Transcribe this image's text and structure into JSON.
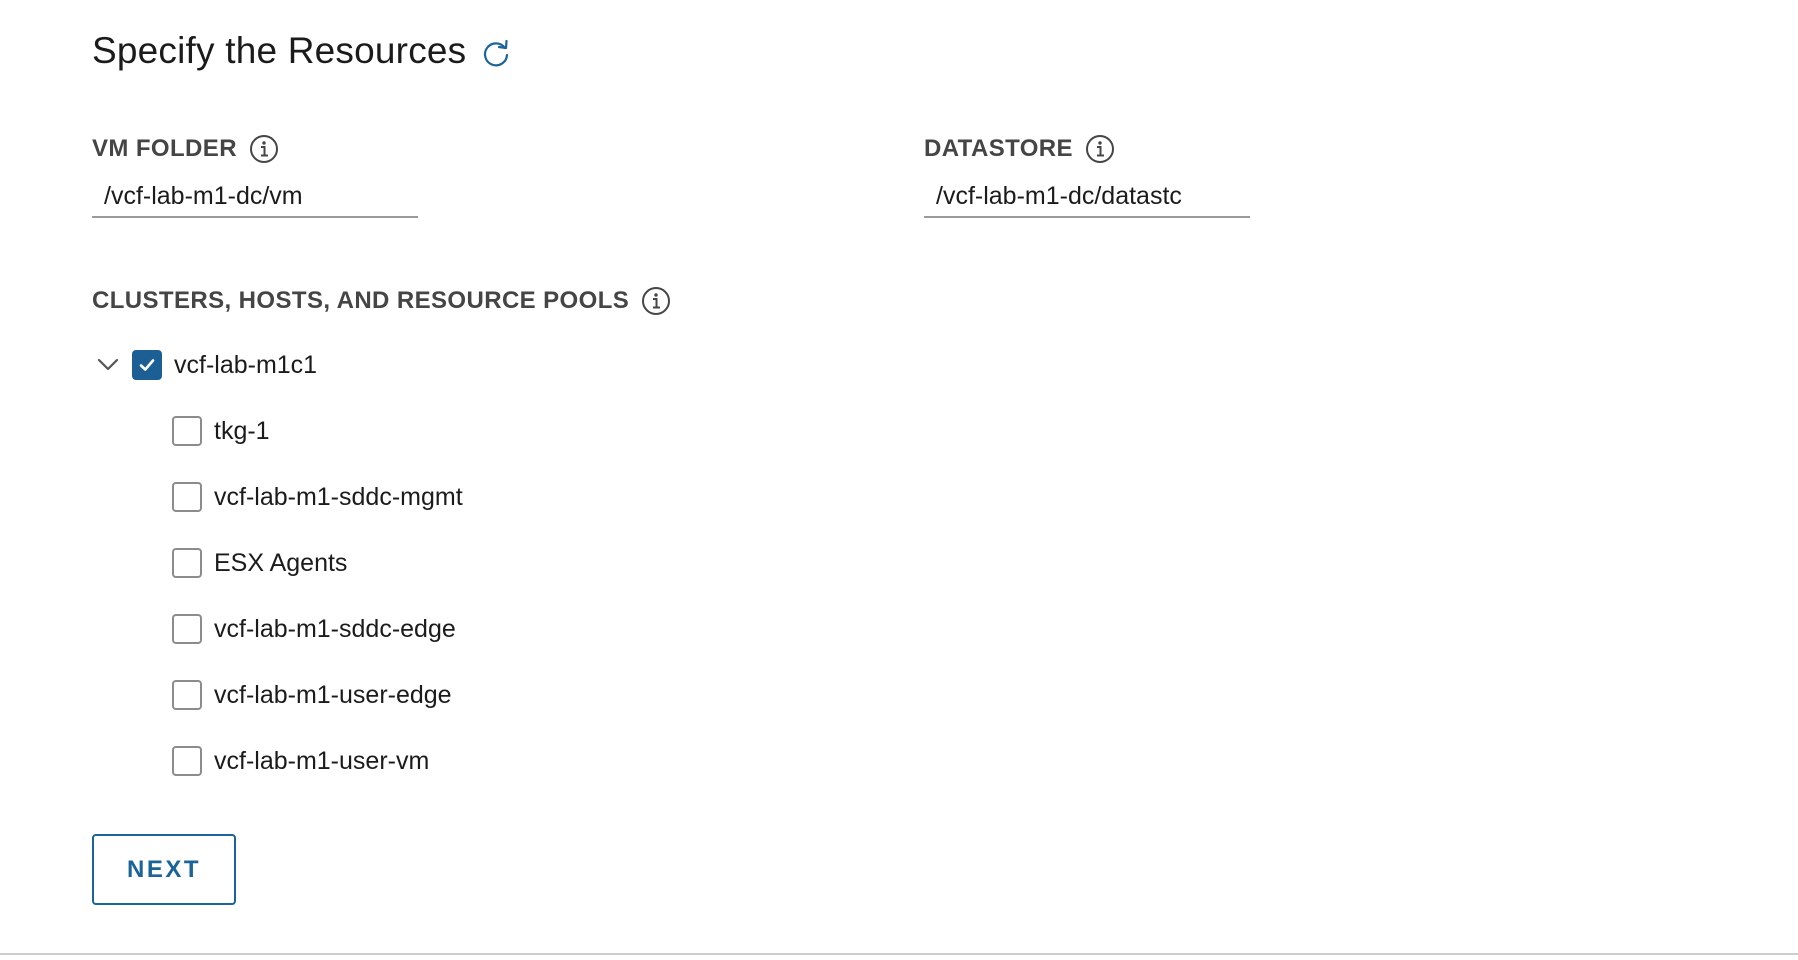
{
  "title": "Specify the Resources",
  "icons": {
    "refresh": "refresh-icon",
    "info": "info-icon",
    "chevron": "chevron-down-icon",
    "check": "check-icon"
  },
  "colors": {
    "accent": "#1b6499",
    "checked": "#1b5f95",
    "label": "#454545"
  },
  "vm_folder": {
    "label": "VM FOLDER",
    "value": "/vcf-lab-m1-dc/vm"
  },
  "datastore": {
    "label": "DATASTORE",
    "value": "/vcf-lab-m1-dc/datastc"
  },
  "resources": {
    "label": "CLUSTERS, HOSTS, AND RESOURCE POOLS",
    "root": {
      "label": "vcf-lab-m1c1",
      "checked": true,
      "expanded": true
    },
    "children": [
      {
        "label": "tkg-1",
        "checked": false
      },
      {
        "label": "vcf-lab-m1-sddc-mgmt",
        "checked": false
      },
      {
        "label": "ESX Agents",
        "checked": false
      },
      {
        "label": "vcf-lab-m1-sddc-edge",
        "checked": false
      },
      {
        "label": "vcf-lab-m1-user-edge",
        "checked": false
      },
      {
        "label": "vcf-lab-m1-user-vm",
        "checked": false
      }
    ]
  },
  "next_button": {
    "label": "NEXT"
  }
}
